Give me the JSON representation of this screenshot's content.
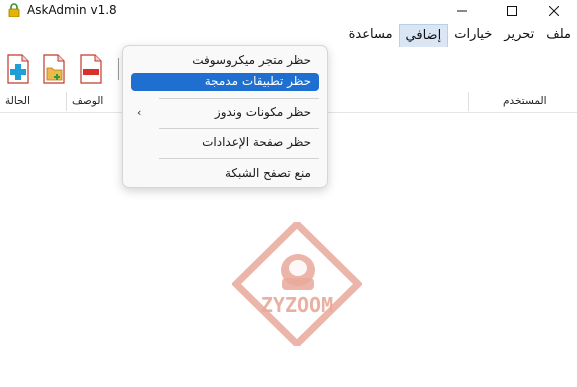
{
  "window": {
    "title": "AskAdmin v1.8"
  },
  "menubar": {
    "items": [
      {
        "label": "ملف"
      },
      {
        "label": "تحرير"
      },
      {
        "label": "خيارات"
      },
      {
        "label": "إضافي"
      },
      {
        "label": "مساعدة"
      }
    ]
  },
  "list": {
    "columns": {
      "user": "المستخدم",
      "description": "الوصف",
      "status": "الحالة"
    }
  },
  "dropdown": {
    "items": [
      {
        "label": "حظر متجر ميكروسوفت"
      },
      {
        "label": "حظر تطبيقات مدمجة"
      },
      {
        "label": "حظر مكونات وندوز"
      },
      {
        "label": "حظر صفحة الإعدادات"
      },
      {
        "label": "منع تصفح الشبكة"
      }
    ]
  },
  "watermark": {
    "text": "ZYZOOM"
  },
  "colors": {
    "highlight": "#1f6fd0",
    "watermark": "#e8a99a"
  }
}
